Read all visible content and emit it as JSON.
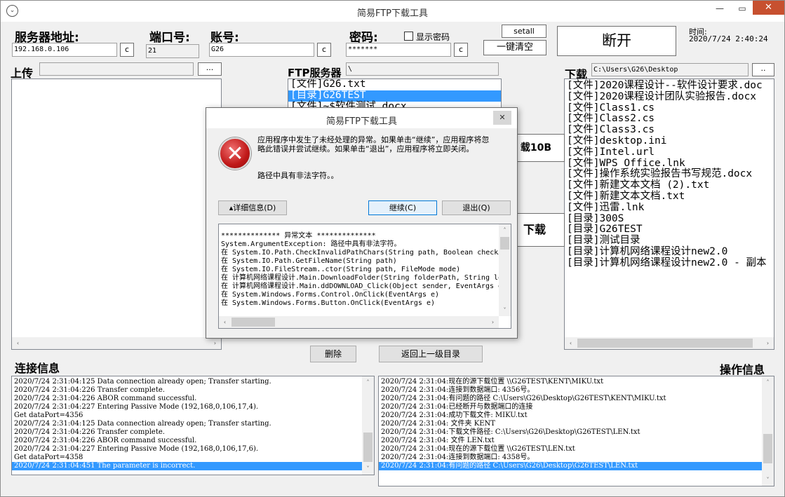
{
  "window": {
    "title": "简易FTP下载工具"
  },
  "connection": {
    "server_label": "服务器地址:",
    "server_value": "192.168.0.106",
    "port_label": "端口号:",
    "port_value": "21",
    "account_label": "账号:",
    "account_value": "G26",
    "password_label": "密码:",
    "password_value": "*******",
    "show_password_label": "显示密码",
    "clear_btn": "c",
    "setall_btn": "setall",
    "clear_all_btn": "一键清空",
    "disconnect_btn": "断开",
    "time_label": "时间:",
    "time_value": "2020/7/24 2:40:24"
  },
  "upload": {
    "label": "上传",
    "path": "",
    "browse_btn": "..."
  },
  "ftp_server": {
    "label": "FTP服务器",
    "path": "\\",
    "items": [
      "[文件]G26.txt",
      "[目录]G26TEST",
      "[文件]~$软件测试.docx"
    ],
    "selected_index": 1
  },
  "download": {
    "label": "下载",
    "path": "C:\\Users\\G26\\Desktop",
    "browse_btn": "..",
    "items": [
      "[文件]2020课程设计--软件设计要求.doc",
      "[文件]2020课程设计团队实验报告.docx",
      "[文件]Class1.cs",
      "[文件]Class2.cs",
      "[文件]Class3.cs",
      "[文件]desktop.ini",
      "[文件]Intel.url",
      "[文件]WPS Office.lnk",
      "[文件]操作系统实验报告书写规范.docx",
      "[文件]新建文本文档 (2).txt",
      "[文件]新建文本文档.txt",
      "[文件]迅雷.lnk",
      "[目录]300S",
      "[目录]G26TEST",
      "[目录]测试目录",
      "[目录]计算机网络课程设计new2.0",
      "[目录]计算机网络课程设计new2.0 - 副本"
    ]
  },
  "middle_buttons": {
    "download_partial": "载10B",
    "download_partial2": "下载",
    "delete_btn": "删除",
    "back_btn": "返回上一级目录"
  },
  "conn_log": {
    "label": "连接信息",
    "lines": [
      "2020/7/24 2:31:04:125 Data connection already open; Transfer starting.",
      "2020/7/24 2:31:04:226 Transfer complete.",
      "2020/7/24 2:31:04:226 ABOR command successful.",
      "2020/7/24 2:31:04:227 Entering Passive Mode (192,168,0,106,17,4).",
      "Get dataPort=4356",
      "2020/7/24 2:31:04:125 Data connection already open; Transfer starting.",
      "2020/7/24 2:31:04:226 Transfer complete.",
      "2020/7/24 2:31:04:226 ABOR command successful.",
      "2020/7/24 2:31:04:227 Entering Passive Mode (192,168,0,106,17,6).",
      "Get dataPort=4358",
      "2020/7/24 2:31:04:451 The parameter is incorrect."
    ],
    "selected_index": 10
  },
  "op_log": {
    "label": "操作信息",
    "lines": [
      "2020/7/24 2:31:04:现在的源下载位置  \\\\G26TEST\\KENT\\MIKU.txt",
      "2020/7/24 2:31:04:连接到数据端口: 4356号。",
      "2020/7/24 2:31:04:有问题的路径  C:\\Users\\G26\\Desktop\\G26TEST\\KENT\\MIKU.txt",
      "2020/7/24 2:31:04:已经断开与数据端口的连接",
      "2020/7/24 2:31:04:成功下载文件: MIKU.txt",
      "2020/7/24 2:31:04:    文件夹 KENT",
      "2020/7/24 2:31:04:下载文件路径: C:\\Users\\G26\\Desktop\\G26TEST\\LEN.txt",
      "2020/7/24 2:31:04:    文件 LEN.txt",
      "2020/7/24 2:31:04:现在的源下载位置  \\\\G26TEST\\LEN.txt",
      "2020/7/24 2:31:04:连接到数据端口: 4358号。",
      "2020/7/24 2:31:04:有问题的路径  C:\\Users\\G26\\Desktop\\G26TEST\\LEN.txt"
    ],
    "selected_index": 10
  },
  "dialog": {
    "title": "简易FTP下载工具",
    "message": "应用程序中发生了未经处理的异常。如果单击“继续”，应用程序将忽略此错误并尝试继续。如果单击“退出”，应用程序将立即关闭。",
    "detail_msg": "路径中具有非法字符。。",
    "details_btn": "▴详细信息(D)",
    "continue_btn": "继续(C)",
    "quit_btn": "退出(Q)",
    "detail_lines": [
      "************** 异常文本 **************",
      "System.ArgumentException: 路径中具有非法字符。",
      "   在 System.IO.Path.CheckInvalidPathChars(String path, Boolean checkAdditional)",
      "   在 System.IO.Path.GetFileName(String path)",
      "   在 System.IO.FileStream..ctor(String path, FileMode mode)",
      "   在 计算机网络课程设计.Main.DownloadFolder(String folderPath, String localPath)",
      "   在 计算机网络课程设计.Main.ddDOWNLOAD_Click(Object sender, EventArgs e)",
      "   在 System.Windows.Forms.Control.OnClick(EventArgs e)",
      "   在 System.Windows.Forms.Button.OnClick(EventArgs e)"
    ]
  },
  "colors": {
    "selection": "#3399ff",
    "error_red": "#c01818"
  }
}
